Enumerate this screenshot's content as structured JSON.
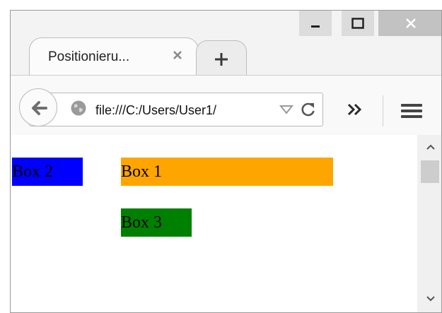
{
  "window": {
    "tab_title": "Positionieru...",
    "url": "file:///C:/Users/User1/",
    "controls": [
      "minimize",
      "maximize",
      "close"
    ]
  },
  "page": {
    "boxes": [
      {
        "label": "Box 1",
        "color": "#ffa500"
      },
      {
        "label": "Box 2",
        "color": "#0000ff"
      },
      {
        "label": "Box 3",
        "color": "#008000"
      }
    ]
  },
  "icons": {
    "back": "back-arrow-icon",
    "site": "globe-icon",
    "dropdown": "dropmarker-icon",
    "reload": "reload-icon",
    "overflow": "chevron-double-right-icon",
    "menu": "hamburger-menu-icon",
    "new_tab": "plus-icon",
    "tab_close": "close-icon"
  }
}
